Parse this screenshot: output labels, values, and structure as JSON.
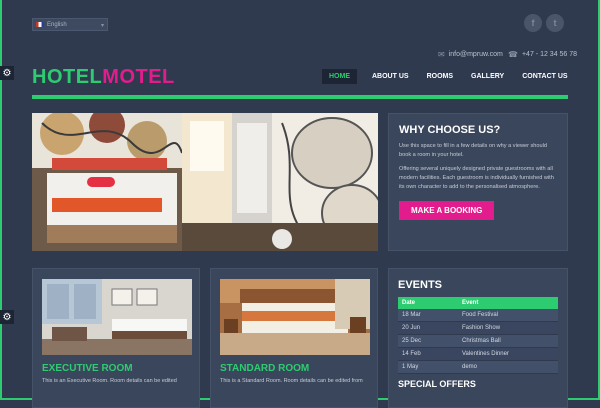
{
  "language": {
    "selected": "English"
  },
  "social": [
    {
      "name": "facebook-icon",
      "glyph": "f"
    },
    {
      "name": "twitter-icon",
      "glyph": "t"
    }
  ],
  "contact": {
    "email": "info@mpruw.com",
    "phone": "+47 - 12 34 56 78"
  },
  "logo": {
    "part1": "HOTEL",
    "part2": "MOTEL"
  },
  "nav": [
    {
      "label": "HOME",
      "active": true
    },
    {
      "label": "ABOUT US"
    },
    {
      "label": "ROOMS"
    },
    {
      "label": "GALLERY"
    },
    {
      "label": "CONTACT US"
    }
  ],
  "why": {
    "title": "WHY CHOOSE US?",
    "p1": "Use this space to fill in a few details on why a viewer should book a room in your hotel.",
    "p2": "Offering several uniquely designed private guestrooms with all modern facilities. Each guestroom is individually furnished with its own character to add to the personalised atmosphere.",
    "button": "MAKE A BOOKING"
  },
  "rooms": [
    {
      "title": "EXECUTIVE ROOM",
      "desc": "This is an Executive Room. Room details can be edited"
    },
    {
      "title": "STANDARD ROOM",
      "desc": "This is a Standard Room. Room details can be edited from"
    }
  ],
  "events": {
    "title": "EVENTS",
    "headers": [
      "Date",
      "Event"
    ],
    "rows": [
      [
        "18 Mar",
        "Food Festival"
      ],
      [
        "20 Jun",
        "Fashion Show"
      ],
      [
        "25 Dec",
        "Christmas Ball"
      ],
      [
        "14 Feb",
        "Valentines Dinner"
      ],
      [
        "1 May",
        "demo"
      ]
    ],
    "next_title": "SPECIAL OFFERS"
  },
  "colors": {
    "accent_green": "#2ecc71",
    "accent_pink": "#e31c8d",
    "background": "#2f3a4e"
  }
}
